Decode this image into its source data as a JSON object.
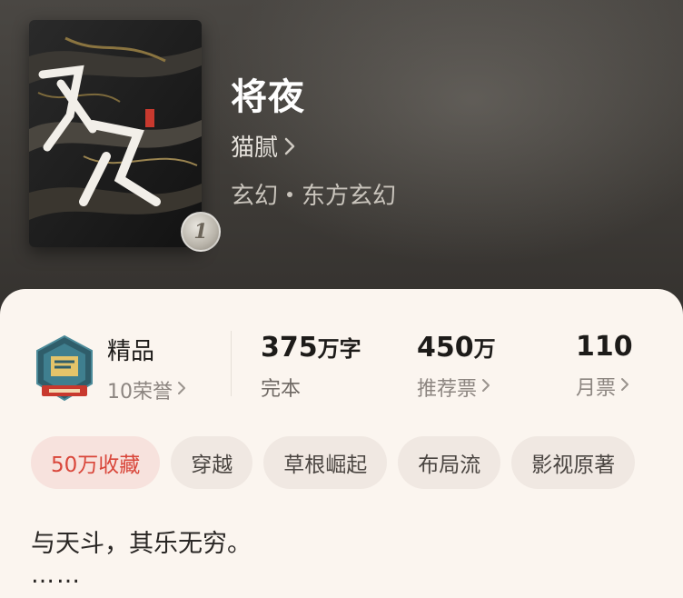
{
  "book": {
    "title": "将夜",
    "author": "猫腻",
    "genre_main": "玄幻",
    "genre_sub": "东方玄幻",
    "cover_badge": "1"
  },
  "stats": {
    "honor_title": "精品",
    "honor_sub": "10荣誉",
    "words_num": "375",
    "words_unit": "万字",
    "words_sub": "完本",
    "rec_num": "450",
    "rec_unit": "万",
    "rec_sub": "推荐票",
    "monthly_num": "110",
    "monthly_sub": "月票"
  },
  "tags": [
    "50万收藏",
    "穿越",
    "草根崛起",
    "布局流",
    "影视原著"
  ],
  "description": "与天斗，其乐无穷。",
  "more": "……",
  "colors": {
    "accent": "#d9463a",
    "card_bg": "#fbf5ef",
    "hero_bg": "#3f3c38"
  },
  "icons": {
    "honor_badge": "hexagon-badge-icon",
    "chevron": "chevron-right-icon"
  }
}
